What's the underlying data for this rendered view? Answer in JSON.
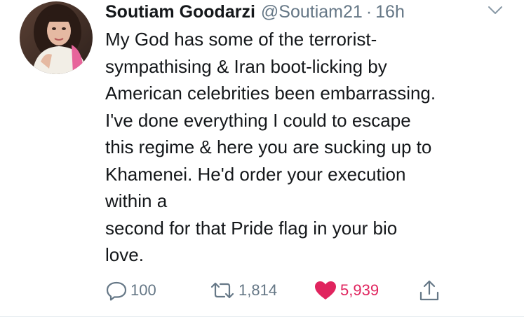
{
  "tweet": {
    "author_name": "Soutiam Goodarzi",
    "handle": "@Soutiam21",
    "separator": "·",
    "time": "16h",
    "text_lines": [
      "My God has some of the terrorist-",
      "sympathising & Iran boot-licking by",
      "American celebrities been embarrassing.",
      "I've done everything I could to escape",
      "this regime & here you are sucking up to",
      "Khamenei. He'd order your execution",
      "within a",
      "second for that Pride flag in your bio",
      "love."
    ]
  },
  "actions": {
    "reply_count": "100",
    "retweet_count": "1,814",
    "like_count": "5,939"
  },
  "icons": {
    "reply": "reply-icon",
    "retweet": "retweet-icon",
    "like": "heart-icon",
    "share": "share-icon",
    "menu": "chevron-down-icon"
  },
  "colors": {
    "text": "#14171a",
    "secondary": "#657786",
    "like": "#e0245e"
  }
}
